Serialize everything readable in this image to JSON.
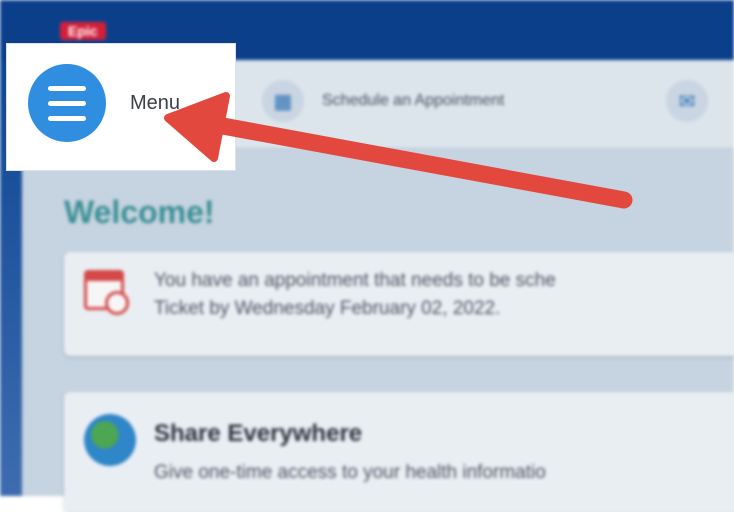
{
  "header": {
    "logo_text": "Epic"
  },
  "menu": {
    "label": "Menu"
  },
  "toolbar": {
    "schedule_label": "Schedule an Appointment"
  },
  "main": {
    "welcome": "Welcome!",
    "appointment_card": {
      "line1": "You have an appointment that needs to be sche",
      "line2": "Ticket by Wednesday February 02, 2022."
    },
    "share_card": {
      "title": "Share Everywhere",
      "line1": "Give one-time access to your health informatio"
    }
  },
  "colors": {
    "topbar": "#0b3f8a",
    "menu_circle": "#2f8ee0",
    "arrow": "#e2483d",
    "welcome": "#3b8f95"
  },
  "icons": {
    "menu": "hamburger-icon",
    "schedule": "calendar-icon",
    "message": "envelope-icon",
    "appointment": "calendar-alert-icon",
    "share": "globe-icon"
  }
}
